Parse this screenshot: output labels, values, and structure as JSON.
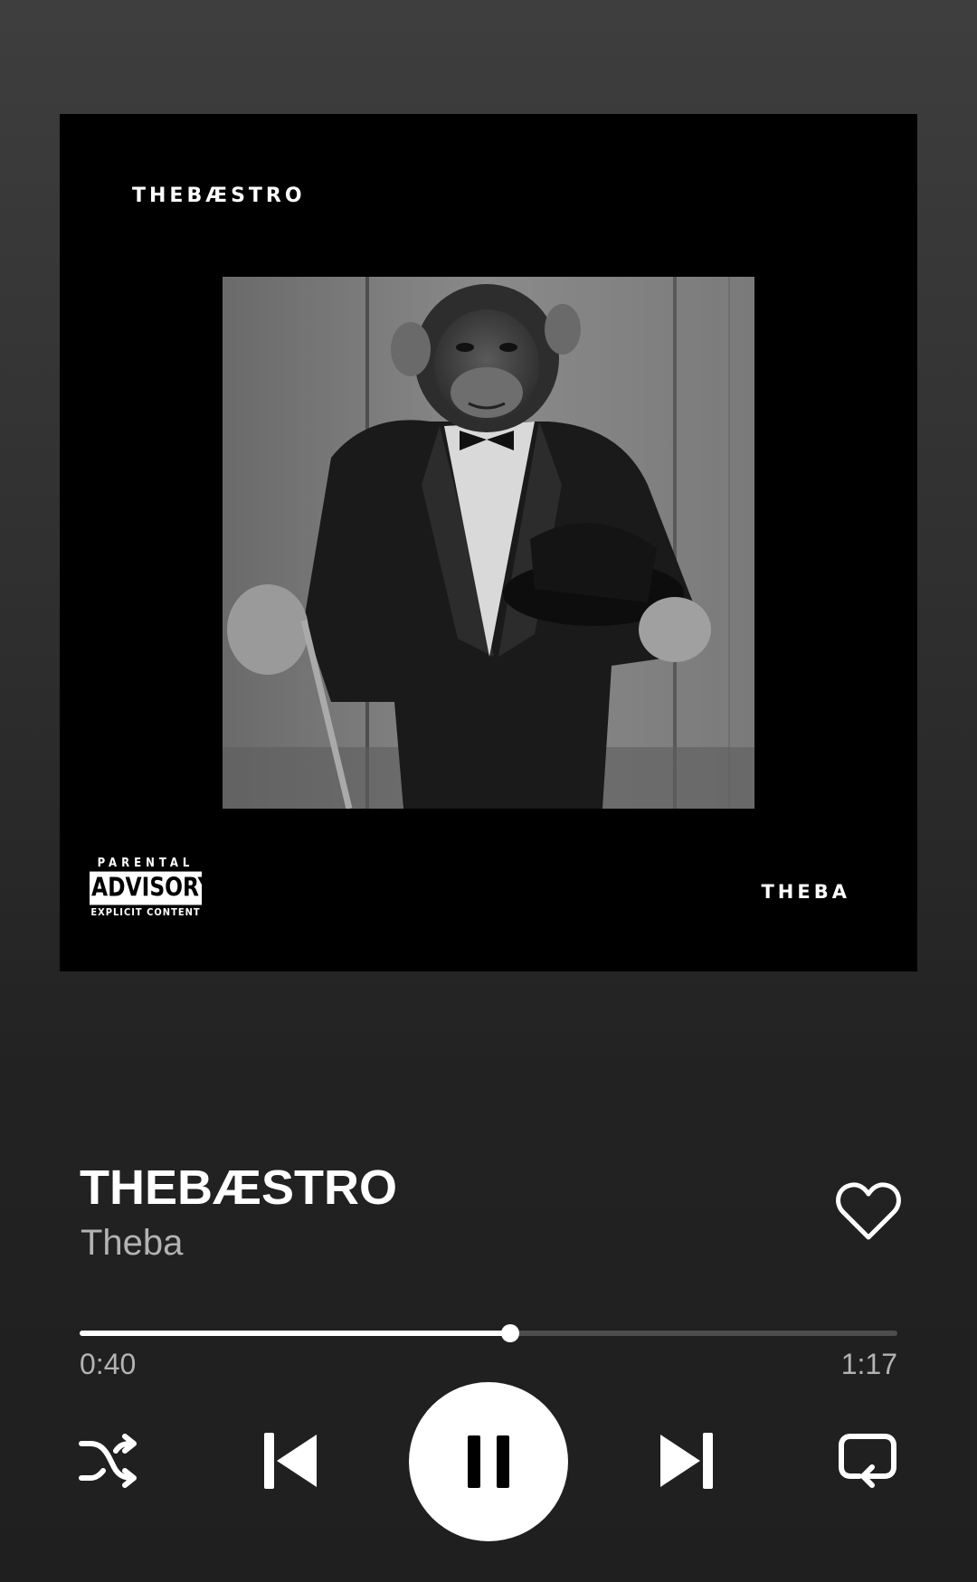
{
  "cover": {
    "title_text": "THEBÆSTRO",
    "artist_text": "THEBA",
    "advisory": {
      "line1": "PARENTAL",
      "line2": "ADVISORY",
      "line3": "EXPLICIT CONTENT"
    },
    "background_color": "#000000",
    "photo_subject": "chimpanzee in tuxedo holding top hat and cane"
  },
  "track": {
    "title": "THEBÆSTRO",
    "artist": "Theba",
    "liked": false
  },
  "playback": {
    "elapsed": "0:40",
    "total": "1:17",
    "progress_fraction": 0.527,
    "is_playing": true
  },
  "controls": {
    "shuffle_icon": "shuffle-icon",
    "previous_icon": "skip-previous-icon",
    "play_pause_icon": "pause-icon",
    "next_icon": "skip-next-icon",
    "repeat_icon": "repeat-icon",
    "like_icon": "heart-outline-icon"
  },
  "colors": {
    "text_primary": "#ffffff",
    "text_secondary": "#b3b3b3",
    "progress_track": "#4d4d4d",
    "progress_fill": "#ffffff"
  }
}
